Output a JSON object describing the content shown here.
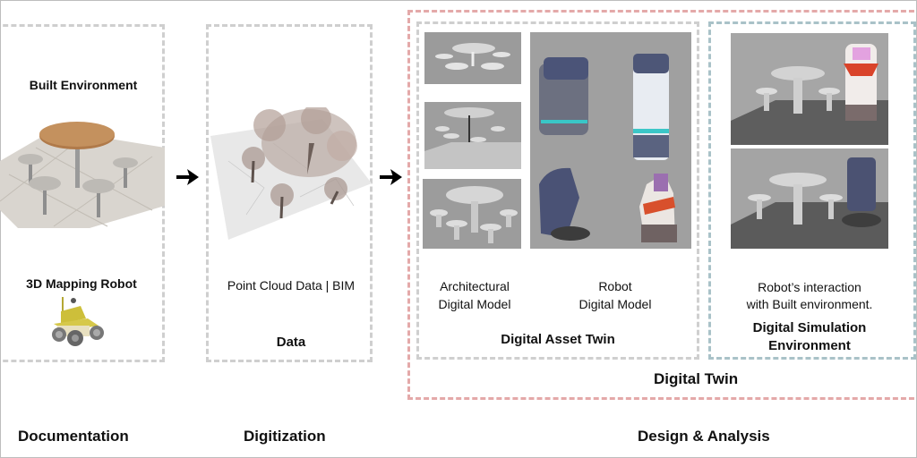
{
  "documentation": {
    "built_environment_label": "Built Environment",
    "mapping_robot_label": "3D Mapping Robot",
    "stage_label": "Documentation"
  },
  "digitization": {
    "data_caption": "Point Cloud Data | BIM",
    "box_title": "Data",
    "stage_label": "Digitization"
  },
  "design": {
    "asset_twin": {
      "architectural_label_line1": "Architectural",
      "architectural_label_line2": "Digital Model",
      "robot_label_line1": "Robot",
      "robot_label_line2": "Digital Model",
      "title": "Digital Asset Twin"
    },
    "simulation": {
      "caption_line1": "Robot’s interaction",
      "caption_line2": "with Built environment.",
      "title_line1": "Digital Simulation",
      "title_line2": "Environment"
    },
    "digital_twin_label": "Digital Twin",
    "stage_label": "Design & Analysis"
  },
  "colors": {
    "gray_dash": "#cfcfcf",
    "red_dash": "#e4a9a9",
    "blue_dash": "#a9c2c8"
  }
}
